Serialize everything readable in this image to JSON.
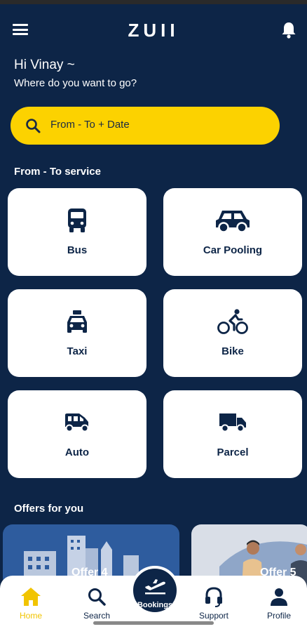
{
  "header": {
    "logo": "ZUII"
  },
  "greeting": {
    "hello": "Hi Vinay ~",
    "question": "Where do you want to go?"
  },
  "search": {
    "placeholder": "From - To + Date"
  },
  "services": {
    "title": "From - To service",
    "items": [
      {
        "label": "Bus",
        "icon": "bus-icon"
      },
      {
        "label": "Car Pooling",
        "icon": "car-icon"
      },
      {
        "label": "Taxi",
        "icon": "taxi-icon"
      },
      {
        "label": "Bike",
        "icon": "bike-icon"
      },
      {
        "label": "Auto",
        "icon": "auto-rickshaw-icon"
      },
      {
        "label": "Parcel",
        "icon": "truck-icon"
      }
    ]
  },
  "offers": {
    "title": "Offers for you",
    "items": [
      {
        "label": "Offer 4"
      },
      {
        "label": "Offer 5"
      }
    ]
  },
  "nav": {
    "home": "Home",
    "search": "Search",
    "bookings": "Bookings",
    "support": "Support",
    "profile": "Profile"
  },
  "colors": {
    "background": "#0d2547",
    "accent": "#fcd200",
    "card": "#ffffff"
  }
}
